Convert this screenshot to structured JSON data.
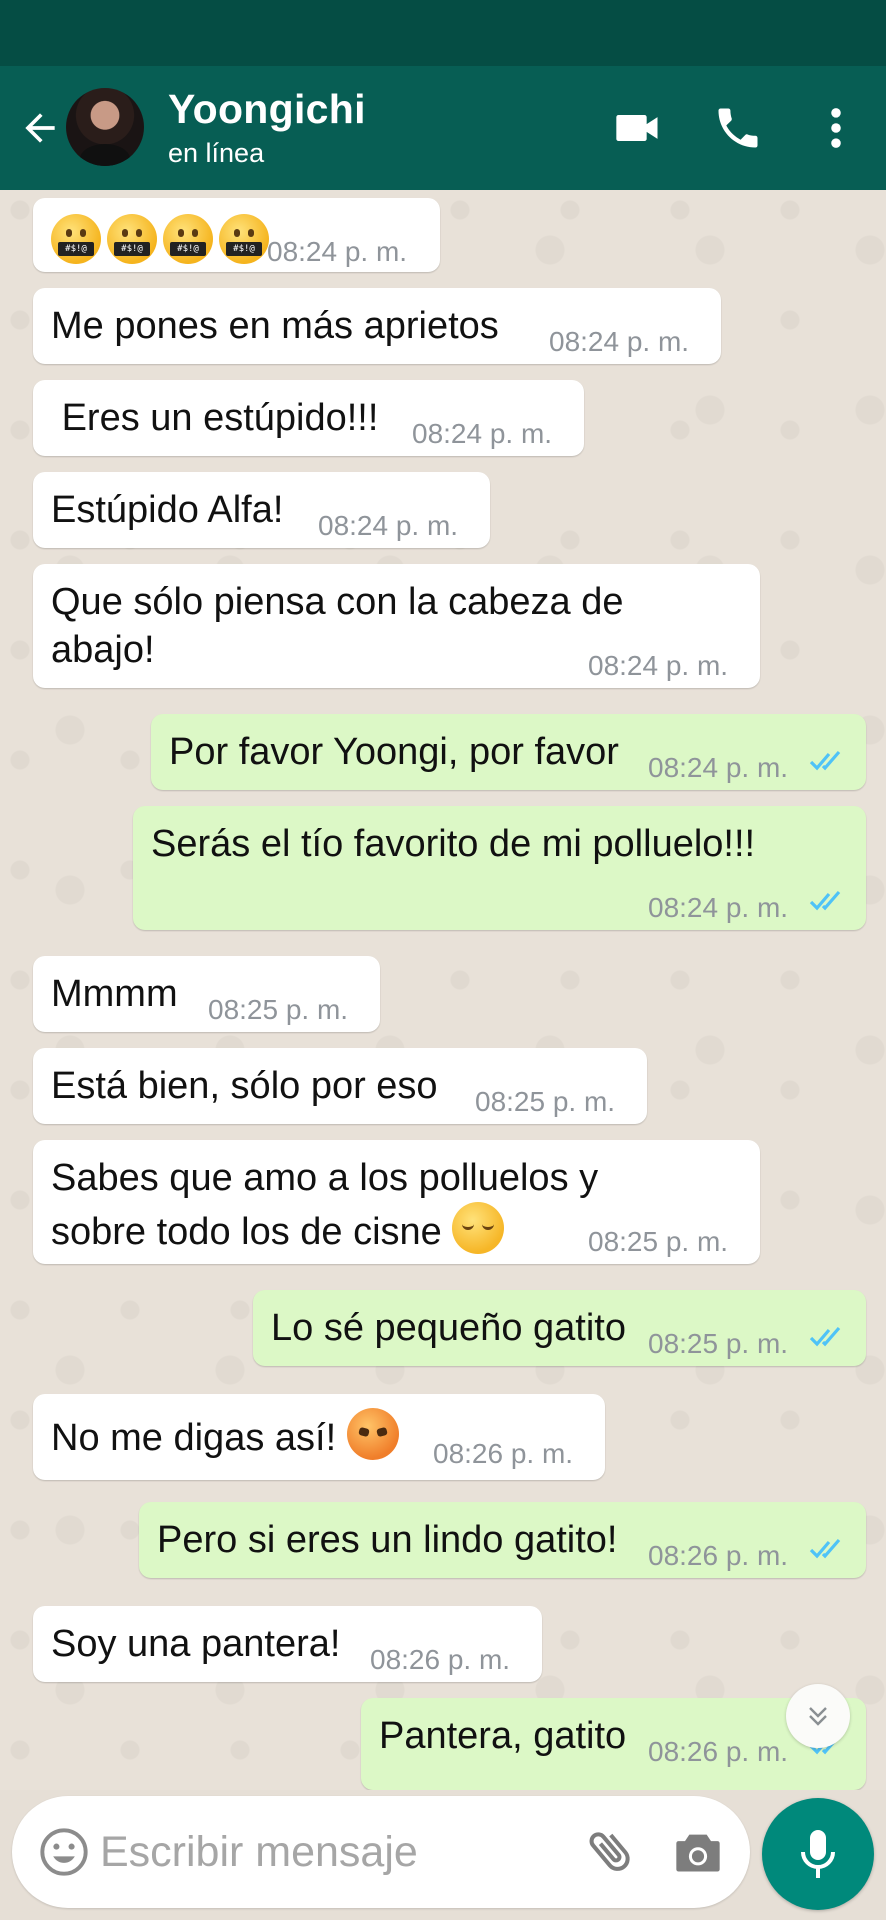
{
  "header": {
    "contact_name": "Yoongichi",
    "contact_status": "en línea",
    "back_icon": "arrow-left-icon",
    "video_icon": "video-camera-icon",
    "call_icon": "phone-icon",
    "menu_icon": "more-vertical-icon"
  },
  "messages": [
    {
      "direction": "in",
      "emojis": [
        "face-with-symbols-on-mouth",
        "face-with-symbols-on-mouth",
        "face-with-symbols-on-mouth",
        "face-with-symbols-on-mouth"
      ],
      "emoji_text": "#$!@",
      "time": "08:24 p. m."
    },
    {
      "direction": "in",
      "text": "Me pones en más aprietos",
      "time": "08:24 p. m."
    },
    {
      "direction": "in",
      "text": " Eres un estúpido!!!",
      "time": "08:24 p. m."
    },
    {
      "direction": "in",
      "text": "Estúpido Alfa!",
      "time": "08:24 p. m."
    },
    {
      "direction": "in",
      "text": "Que sólo piensa con la cabeza de\nabajo!",
      "time": "08:24 p. m."
    },
    {
      "direction": "out",
      "text": "Por favor Yoongi, por favor",
      "time": "08:24 p. m.",
      "read": true
    },
    {
      "direction": "out",
      "text": "Serás el tío favorito de mi polluelo!!!",
      "time": "08:24 p. m.",
      "read": true
    },
    {
      "direction": "in",
      "text": "Mmmm",
      "time": "08:25 p. m."
    },
    {
      "direction": "in",
      "text": "Está bien, sólo por eso",
      "time": "08:25 p. m."
    },
    {
      "direction": "in",
      "text": "Sabes que amo a los polluelos y\nsobre todo los de cisne ",
      "emoji": "relieved-face",
      "time": "08:25 p. m."
    },
    {
      "direction": "out",
      "text": "Lo sé pequeño gatito",
      "time": "08:25 p. m.",
      "read": true
    },
    {
      "direction": "in",
      "text": "No me digas así! ",
      "emoji": "angry-face",
      "time": "08:26 p. m."
    },
    {
      "direction": "out",
      "text": "Pero si eres un lindo gatito!",
      "time": "08:26 p. m.",
      "read": true
    },
    {
      "direction": "in",
      "text": "Soy una pantera!",
      "time": "08:26 p. m."
    },
    {
      "direction": "out",
      "text": "Pantera, gatito",
      "time": "08:26 p. m.",
      "read": true
    }
  ],
  "composer": {
    "placeholder": "Escribir mensaje",
    "emoji_icon": "smiley-icon",
    "attach_icon": "paperclip-icon",
    "camera_icon": "camera-icon",
    "mic_icon": "microphone-icon",
    "scroll_icon": "double-chevron-down-icon"
  },
  "colors": {
    "header": "#075e54",
    "statusbar": "#054d44",
    "outgoing_bubble": "#dcf8c6",
    "incoming_bubble": "#ffffff",
    "read_ticks": "#4fc3f7",
    "mic_button": "#00897b"
  }
}
